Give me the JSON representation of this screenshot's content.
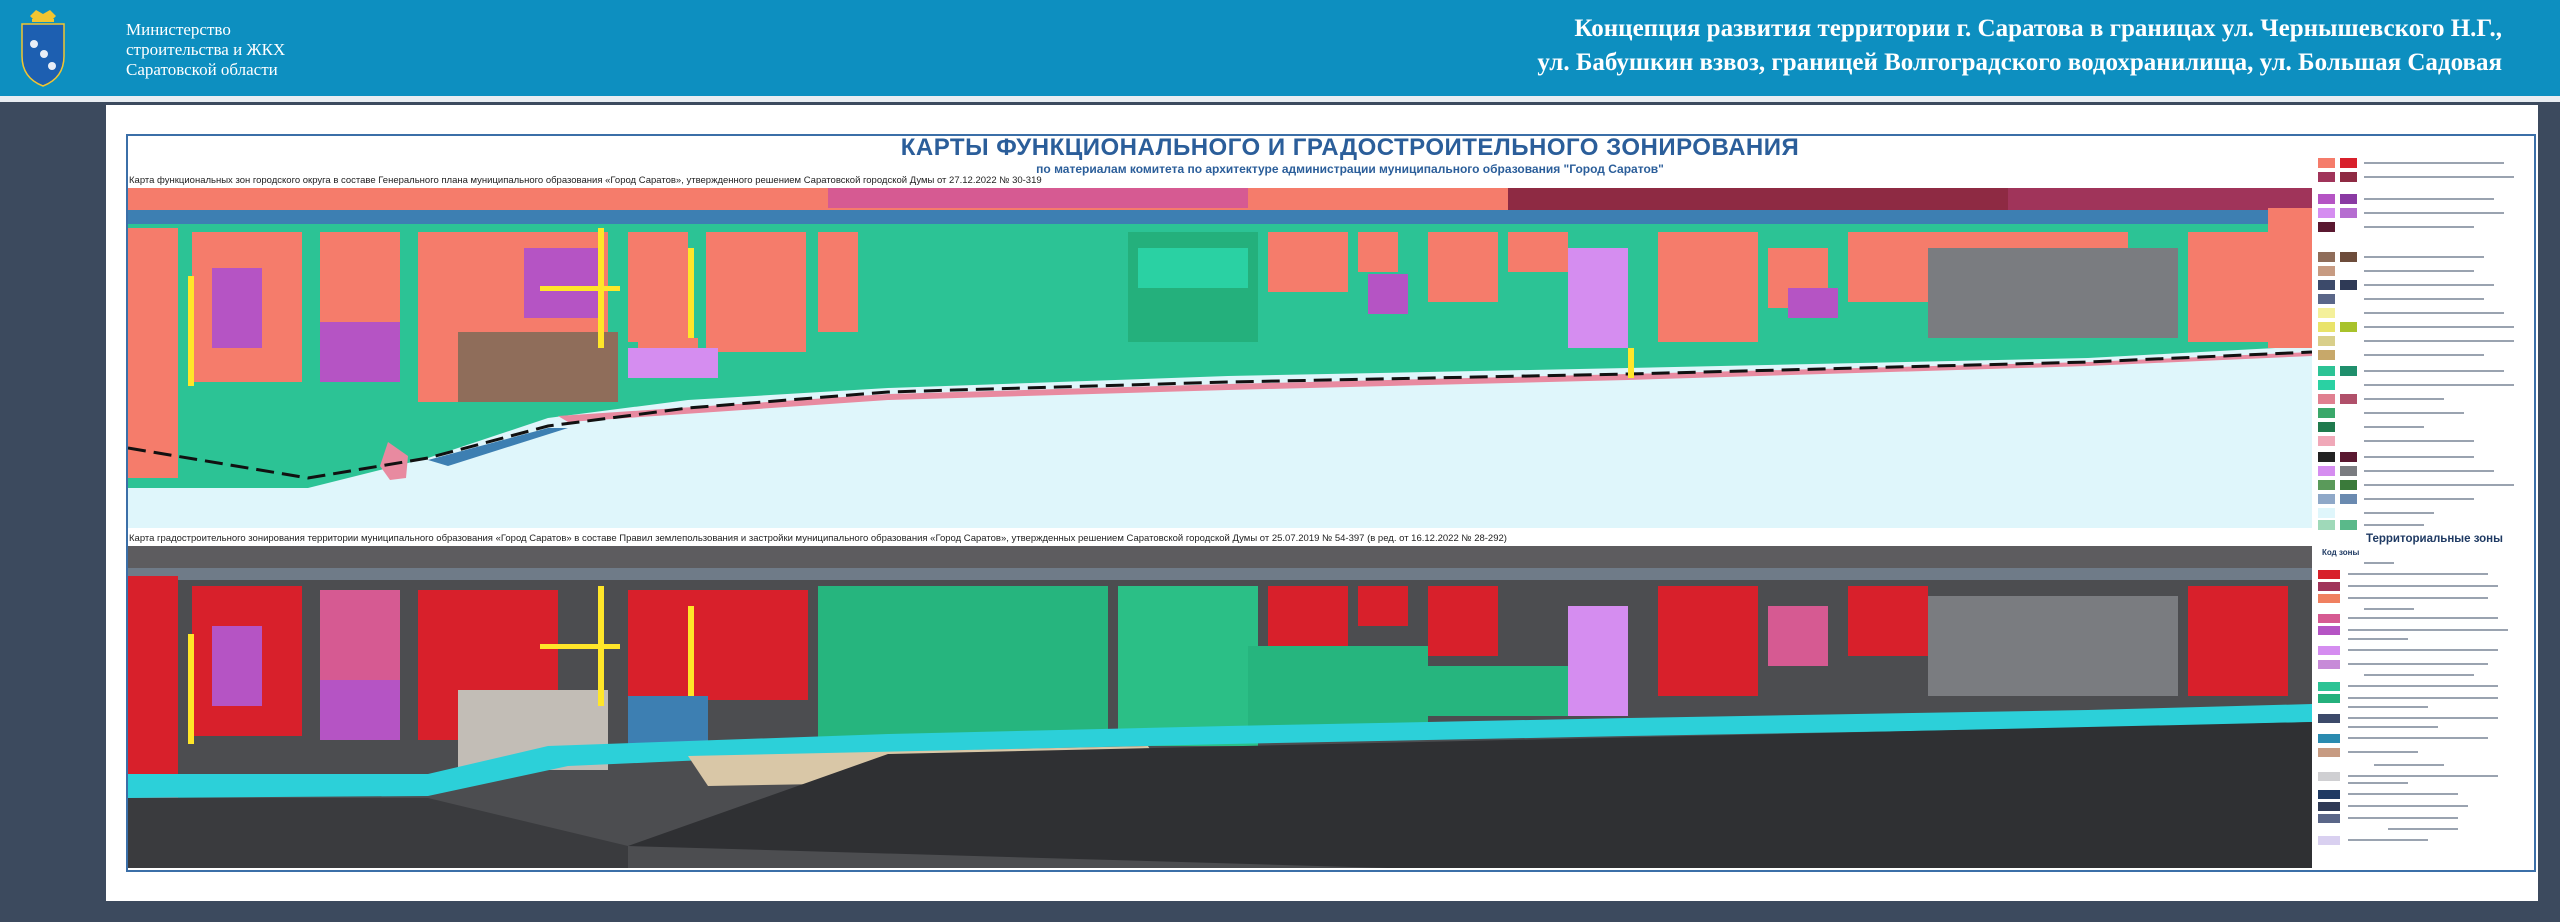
{
  "header": {
    "ministry_line1": "Министерство",
    "ministry_line2": "строительства и ЖКХ",
    "ministry_line3": "Саратовской  области",
    "title_line1": "Концепция развития территории г. Саратова в границах ул. Чернышевского Н.Г.,",
    "title_line2": "ул. Бабушкин взвоз, границей Волгоградского водохранилища, ул. Большая Садовая"
  },
  "map": {
    "title": "КАРТЫ ФУНКЦИОНАЛЬНОГО И ГРАДОСТРОИТЕЛЬНОГО ЗОНИРОВАНИЯ",
    "subtitle": "по материалам комитета по архитектуре  администрации муниципального образования  \"Город Саратов\"",
    "caption_top": "Карта функциональных зон городского округа в составе Генерального плана муниципального образования «Город Саратов», утвержденного решением Саратовской городской Думы от 27.12.2022 № 30-319",
    "caption_bottom": "Карта градостроительного зонирования территории муниципального образования «Город Саратов» в составе Правил землепользования и застройки муниципального образования «Город Саратов», утвержденных решением Саратовской городской Думы от 25.07.2019 № 54-397 (в ред. от 16.12.2022 № 28-292)",
    "legend_title": "Территориальные зоны",
    "legend_code_label": "Код зоны"
  },
  "colors": {
    "header_blue": "#0d8fc0",
    "side_dark": "#3c4a5e",
    "residential_salmon": "#f57c6b",
    "public_purple": "#b554c4",
    "green_zone": "#2cc395",
    "industrial_brown": "#8f6d5a",
    "water_light": "#dff6fb",
    "road_blue": "#3d7fb2",
    "red_zone": "#d8202b",
    "gray_zone": "#7a7c80"
  }
}
